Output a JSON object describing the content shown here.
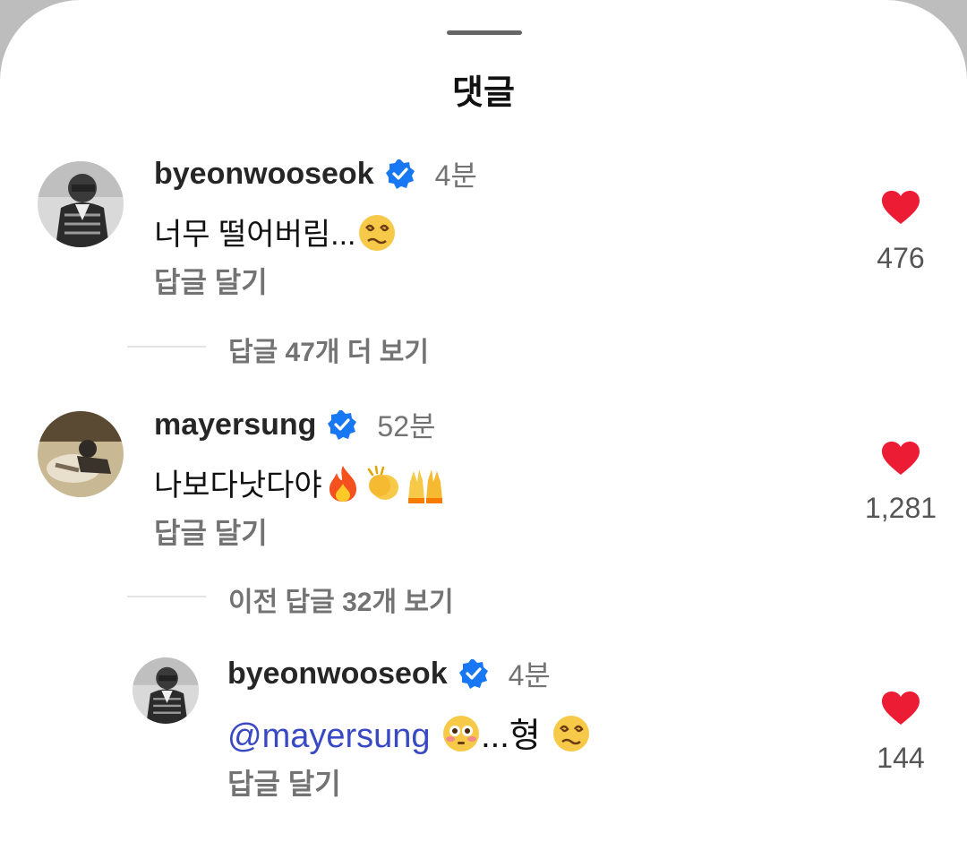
{
  "sheet": {
    "title": "댓글"
  },
  "comments": [
    {
      "username": "byeonwooseok",
      "time": "4분",
      "text": "너무 떨어버림...",
      "text_emojis": [
        "woozy-face-emoji"
      ],
      "reply_label": "답글 달기",
      "likes": "476"
    },
    {
      "username": "mayersung",
      "time": "52분",
      "text": "나보다낫다야",
      "text_emojis": [
        "fire-emoji",
        "clapping-hands-emoji",
        "raising-hands-emoji"
      ],
      "reply_label": "답글 달기",
      "likes": "1,281"
    }
  ],
  "more_replies": [
    {
      "label": "답글 47개 더 보기"
    },
    {
      "label": "이전 답글 32개 보기"
    }
  ],
  "reply": {
    "username": "byeonwooseok",
    "time": "4분",
    "mention": "@mayersung",
    "text": "...형",
    "text_emojis": [
      "flushed-face-emoji",
      "woozy-face-emoji"
    ],
    "reply_label": "답글 달기",
    "likes": "144"
  },
  "colors": {
    "heart": "#ed1c35",
    "verified": "#1877f2",
    "mention": "#3949c4",
    "muted": "#737373"
  }
}
